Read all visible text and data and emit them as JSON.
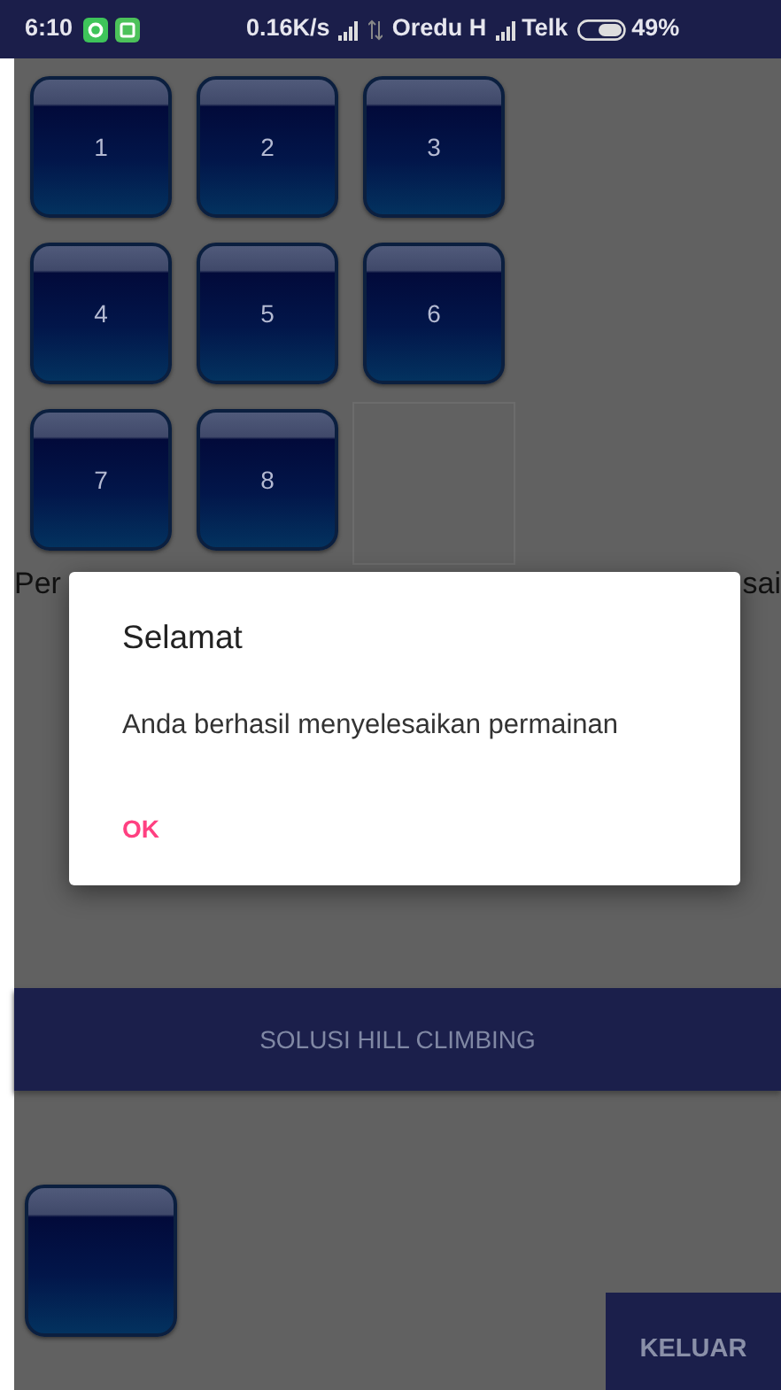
{
  "status_bar": {
    "time": "6:10",
    "speed": "0.16K/s",
    "carrier_1": "Oredu H",
    "carrier_2": "Telk",
    "battery": "49%"
  },
  "board": [
    {
      "kind": "tile",
      "label": "1"
    },
    {
      "kind": "tile",
      "label": "2"
    },
    {
      "kind": "tile",
      "label": "3"
    },
    {
      "kind": "tile",
      "label": "4"
    },
    {
      "kind": "tile",
      "label": "5"
    },
    {
      "kind": "tile",
      "label": "6"
    },
    {
      "kind": "tile",
      "label": "7"
    },
    {
      "kind": "tile",
      "label": "8"
    },
    {
      "kind": "empty"
    }
  ],
  "status_text": {
    "left": "Per",
    "right": "sai"
  },
  "solve_button": "SOLUSI HILL CLIMBING",
  "preview_tiles": [
    {
      "kind": "tile"
    }
  ],
  "exit_button": "KELUAR",
  "dialog": {
    "title": "Selamat",
    "message": "Anda berhasil menyelesaikan permainan",
    "button": "OK"
  }
}
